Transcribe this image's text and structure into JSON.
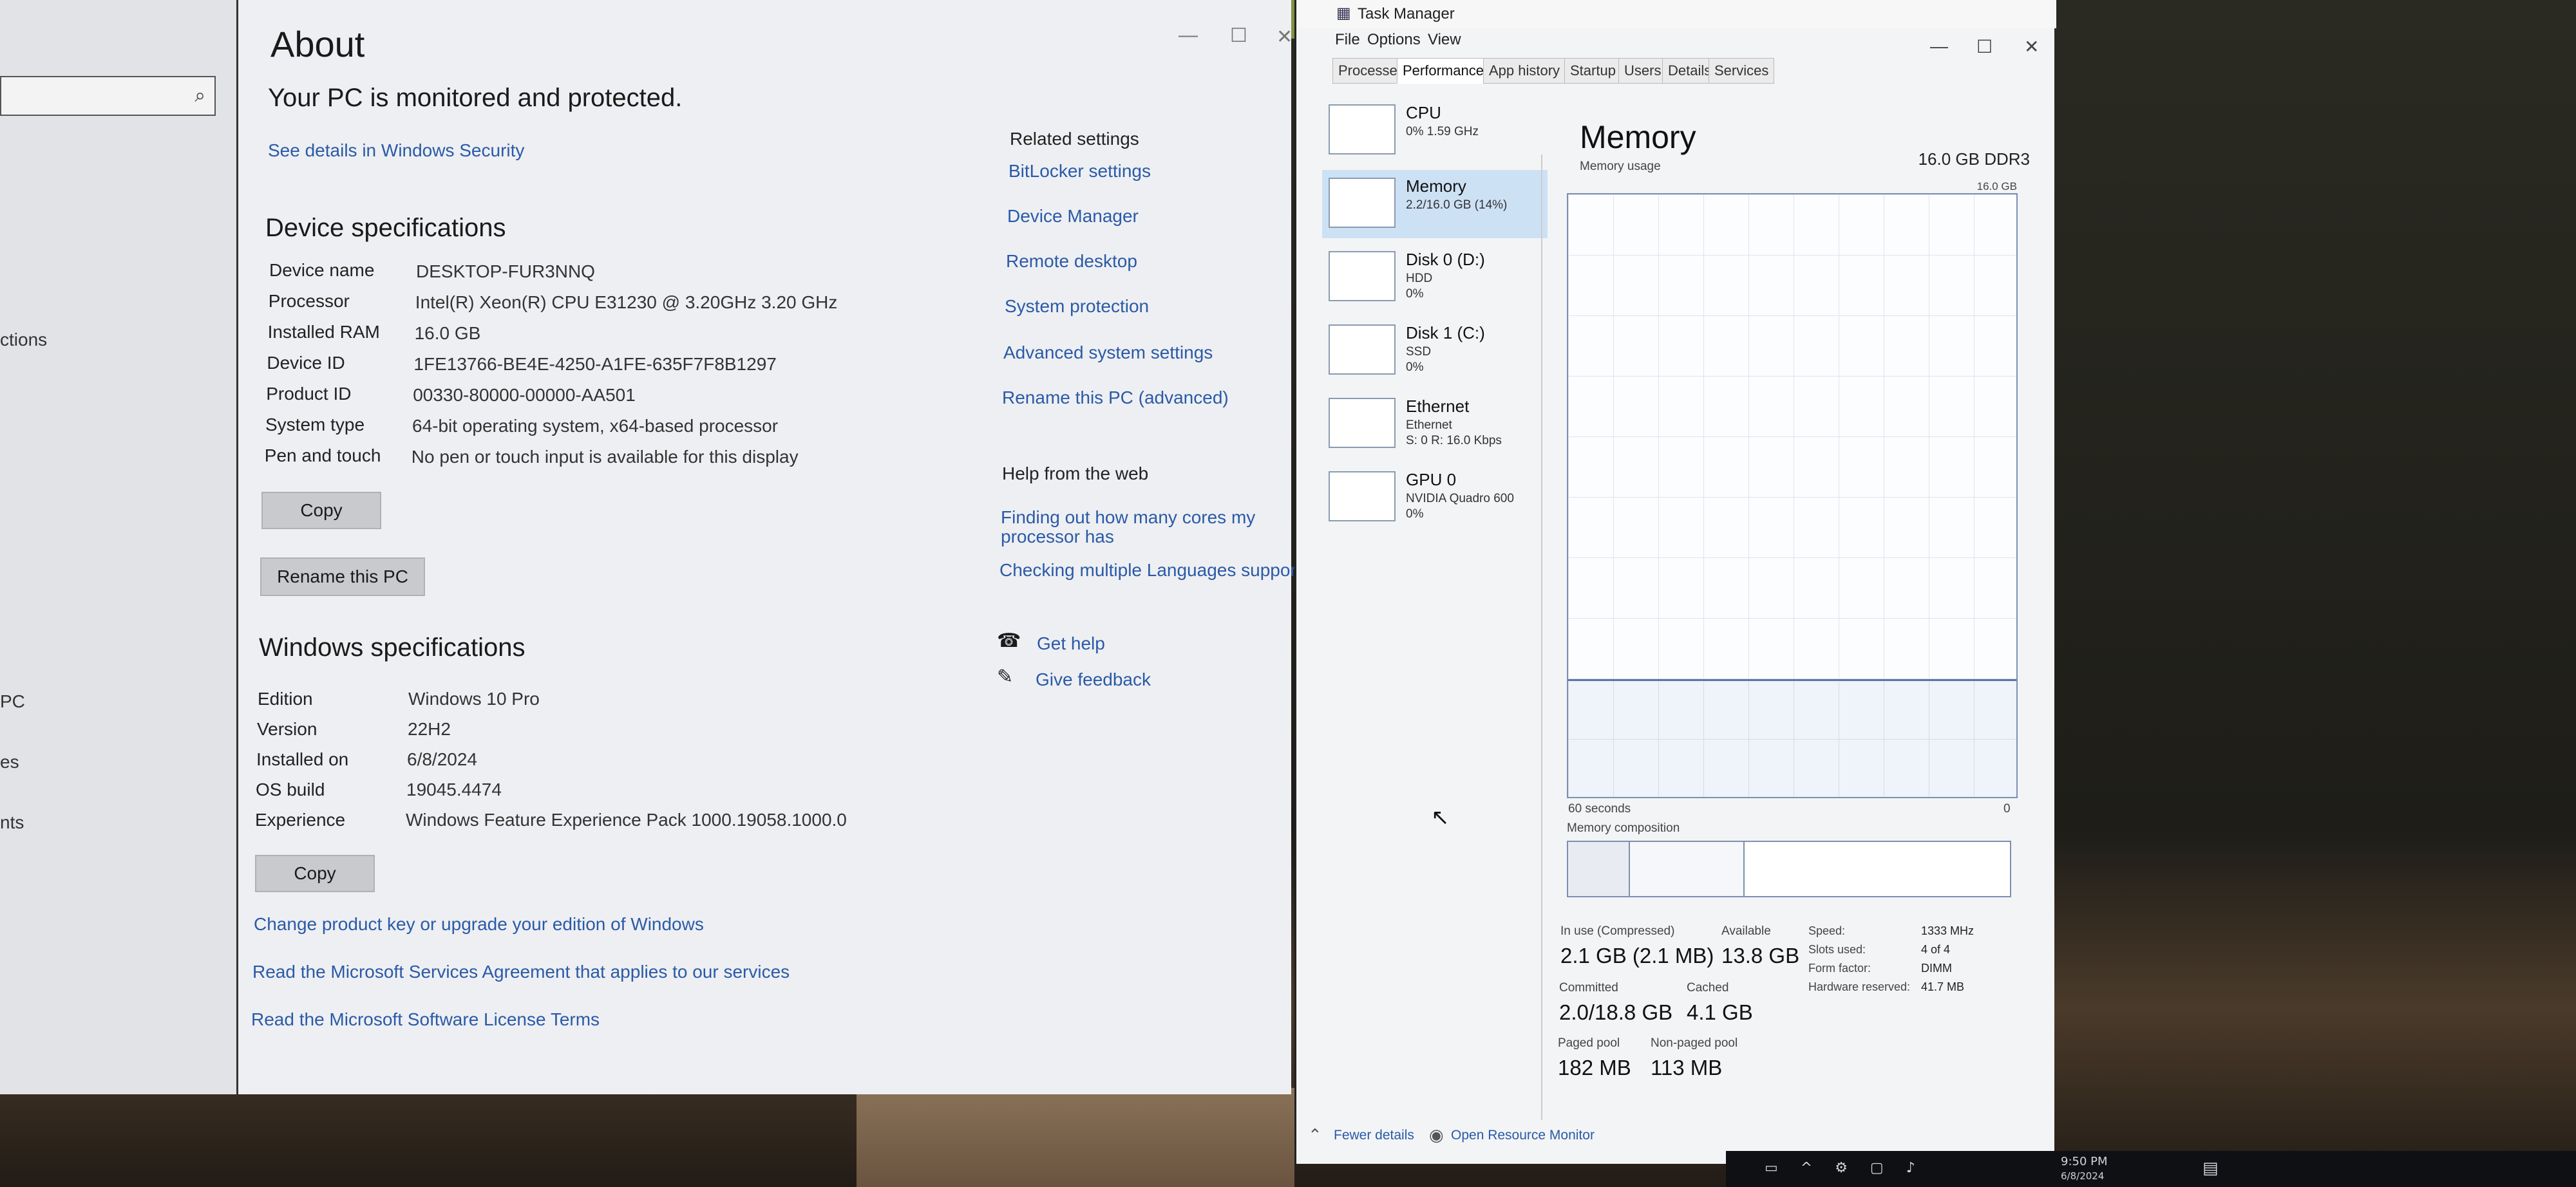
{
  "settings": {
    "nav": {
      "items": [
        "ctions",
        "PC",
        "es",
        "nts"
      ]
    },
    "title": "About",
    "security_status": "Your PC is monitored and protected.",
    "security_link": "See details in Windows Security",
    "device_specs": {
      "heading": "Device specifications",
      "rows": [
        {
          "label": "Device name",
          "value": "DESKTOP-FUR3NNQ"
        },
        {
          "label": "Processor",
          "value": "Intel(R) Xeon(R) CPU E31230 @ 3.20GHz   3.20 GHz"
        },
        {
          "label": "Installed RAM",
          "value": "16.0 GB"
        },
        {
          "label": "Device ID",
          "value": "1FE13766-BE4E-4250-A1FE-635F7F8B1297"
        },
        {
          "label": "Product ID",
          "value": "00330-80000-00000-AA501"
        },
        {
          "label": "System type",
          "value": "64-bit operating system, x64-based processor"
        },
        {
          "label": "Pen and touch",
          "value": "No pen or touch input is available for this display"
        }
      ],
      "copy_label": "Copy",
      "rename_label": "Rename this PC"
    },
    "windows_specs": {
      "heading": "Windows specifications",
      "rows": [
        {
          "label": "Edition",
          "value": "Windows 10 Pro"
        },
        {
          "label": "Version",
          "value": "22H2"
        },
        {
          "label": "Installed on",
          "value": "6/8/2024"
        },
        {
          "label": "OS build",
          "value": "19045.4474"
        },
        {
          "label": "Experience",
          "value": "Windows Feature Experience Pack 1000.19058.1000.0"
        }
      ],
      "copy_label": "Copy"
    },
    "bottom_links": [
      "Change product key or upgrade your edition of Windows",
      "Read the Microsoft Services Agreement that applies to our services",
      "Read the Microsoft Software License Terms"
    ],
    "related": {
      "heading": "Related settings",
      "links": [
        "BitLocker settings",
        "Device Manager",
        "Remote desktop",
        "System protection",
        "Advanced system settings",
        "Rename this PC (advanced)"
      ]
    },
    "help_web": {
      "heading": "Help from the web",
      "links": [
        "Finding out how many cores my",
        "processor has",
        "Checking multiple Languages support"
      ]
    },
    "get_help": "Get help",
    "give_feedback": "Give feedback"
  },
  "task_manager": {
    "title": "Task Manager",
    "menu": [
      "File",
      "Options",
      "View"
    ],
    "tabs": [
      "Processes",
      "Performance",
      "App history",
      "Startup",
      "Users",
      "Details",
      "Services"
    ],
    "active_tab": "Performance",
    "sidebar": [
      {
        "name": "CPU",
        "sub1": "0%  1.59 GHz",
        "sub2": ""
      },
      {
        "name": "Memory",
        "sub1": "2.2/16.0 GB (14%)",
        "sub2": ""
      },
      {
        "name": "Disk 0 (D:)",
        "sub1": "HDD",
        "sub2": "0%"
      },
      {
        "name": "Disk 1 (C:)",
        "sub1": "SSD",
        "sub2": "0%"
      },
      {
        "name": "Ethernet",
        "sub1": "Ethernet",
        "sub2": "S: 0  R: 16.0 Kbps"
      },
      {
        "name": "GPU 0",
        "sub1": "NVIDIA Quadro 600",
        "sub2": "0%"
      }
    ],
    "memory": {
      "title": "Memory",
      "total": "16.0 GB DDR3",
      "usage_label": "Memory usage",
      "max_label": "16.0 GB",
      "time_label": "60 seconds",
      "zero_label": "0",
      "usage_fraction": 0.14,
      "composition_label": "Memory composition",
      "composition_in_use_fraction": 0.14,
      "composition_modified_fraction": 0.26,
      "in_use_label": "In use (Compressed)",
      "in_use_value": "2.1 GB (2.1 MB)",
      "available_label": "Available",
      "available_value": "13.8 GB",
      "committed_label": "Committed",
      "committed_value": "2.0/18.8 GB",
      "cached_label": "Cached",
      "cached_value": "4.1 GB",
      "paged_label": "Paged pool",
      "paged_value": "182 MB",
      "nonpaged_label": "Non-paged pool",
      "nonpaged_value": "113 MB",
      "details": [
        {
          "label": "Speed:",
          "value": "1333 MHz"
        },
        {
          "label": "Slots used:",
          "value": "4 of 4"
        },
        {
          "label": "Form factor:",
          "value": "DIMM"
        },
        {
          "label": "Hardware reserved:",
          "value": "41.7 MB"
        }
      ]
    },
    "fewer_details": "Fewer details",
    "open_monitor": "Open Resource Monitor"
  },
  "taskbar": {
    "time": "9:50 PM",
    "date": "6/8/2024"
  }
}
